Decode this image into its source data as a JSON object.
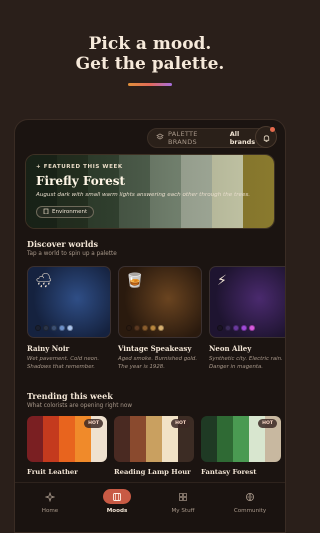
{
  "hero": {
    "line1": "Pick a mood.",
    "line2": "Get the palette."
  },
  "brand_filter": {
    "label": "PALETTE BRANDS",
    "value": "All brands"
  },
  "featured": {
    "tag": "+ FEATURED THIS WEEK",
    "title": "Firefly Forest",
    "description": "August dark with small warm lights answering each other through the trees.",
    "chip": "Environment",
    "colors": [
      "#1d2a1c",
      "#2c3a27",
      "#3c4f3a",
      "#5a6c58",
      "#7f8f7b",
      "#a9b2a0",
      "#c6c8a8",
      "#8a7a2e"
    ]
  },
  "discover": {
    "title": "Discover worlds",
    "subtitle": "Tap a world to spin up a palette",
    "items": [
      {
        "name": "Rainy Noir",
        "description": "Wet pavement. Cold neon. Shadows that remember.",
        "icon": "cloud-rain-icon",
        "glyph": "🌧",
        "bg": "#15223f",
        "glow": "#2f4e86",
        "dots": [
          "#1a2030",
          "#2a3448",
          "#3b4f72",
          "#6c8fc8",
          "#aac4ee"
        ]
      },
      {
        "name": "Vintage Speakeasy",
        "description": "Aged smoke. Burnished gold. The year is 1928.",
        "icon": "whiskey-glass-icon",
        "glyph": "🥃",
        "bg": "#2a1a0e",
        "glow": "#6a4420",
        "dots": [
          "#2a1a10",
          "#5a3820",
          "#8a5c2c",
          "#b8863e",
          "#d8b070"
        ]
      },
      {
        "name": "Neon Alley",
        "description": "Synthetic city. Electric rain. Danger in magenta.",
        "icon": "lightning-icon",
        "glyph": "⚡",
        "bg": "#1e1430",
        "glow": "#4a2a6e",
        "dots": [
          "#1a1424",
          "#3a2a58",
          "#6a3a9e",
          "#a04ad8",
          "#d85ae0"
        ]
      }
    ]
  },
  "trending": {
    "title": "Trending this week",
    "subtitle": "What colorists are opening right now",
    "items": [
      {
        "name": "Fruit Leather",
        "badge": "HOT",
        "colors": [
          "#7a1f22",
          "#c43a1e",
          "#e8641e",
          "#f08a2a",
          "#efe1cf"
        ]
      },
      {
        "name": "Reading Lamp Hour",
        "badge": "HOT",
        "colors": [
          "#4a2a22",
          "#8a4a2e",
          "#c9a060",
          "#f1e2c6",
          "#3c2c24"
        ]
      },
      {
        "name": "Fantasy Forest",
        "badge": "HOT",
        "colors": [
          "#1f3a24",
          "#2f6a34",
          "#4a9a52",
          "#d8e6cf",
          "#c8b8a0"
        ]
      }
    ]
  },
  "nav": {
    "items": [
      {
        "label": "Home",
        "icon": "sparkle-icon"
      },
      {
        "label": "Moods",
        "icon": "film-icon"
      },
      {
        "label": "My Stuff",
        "icon": "grid-icon"
      },
      {
        "label": "Community",
        "icon": "globe-icon"
      }
    ]
  }
}
